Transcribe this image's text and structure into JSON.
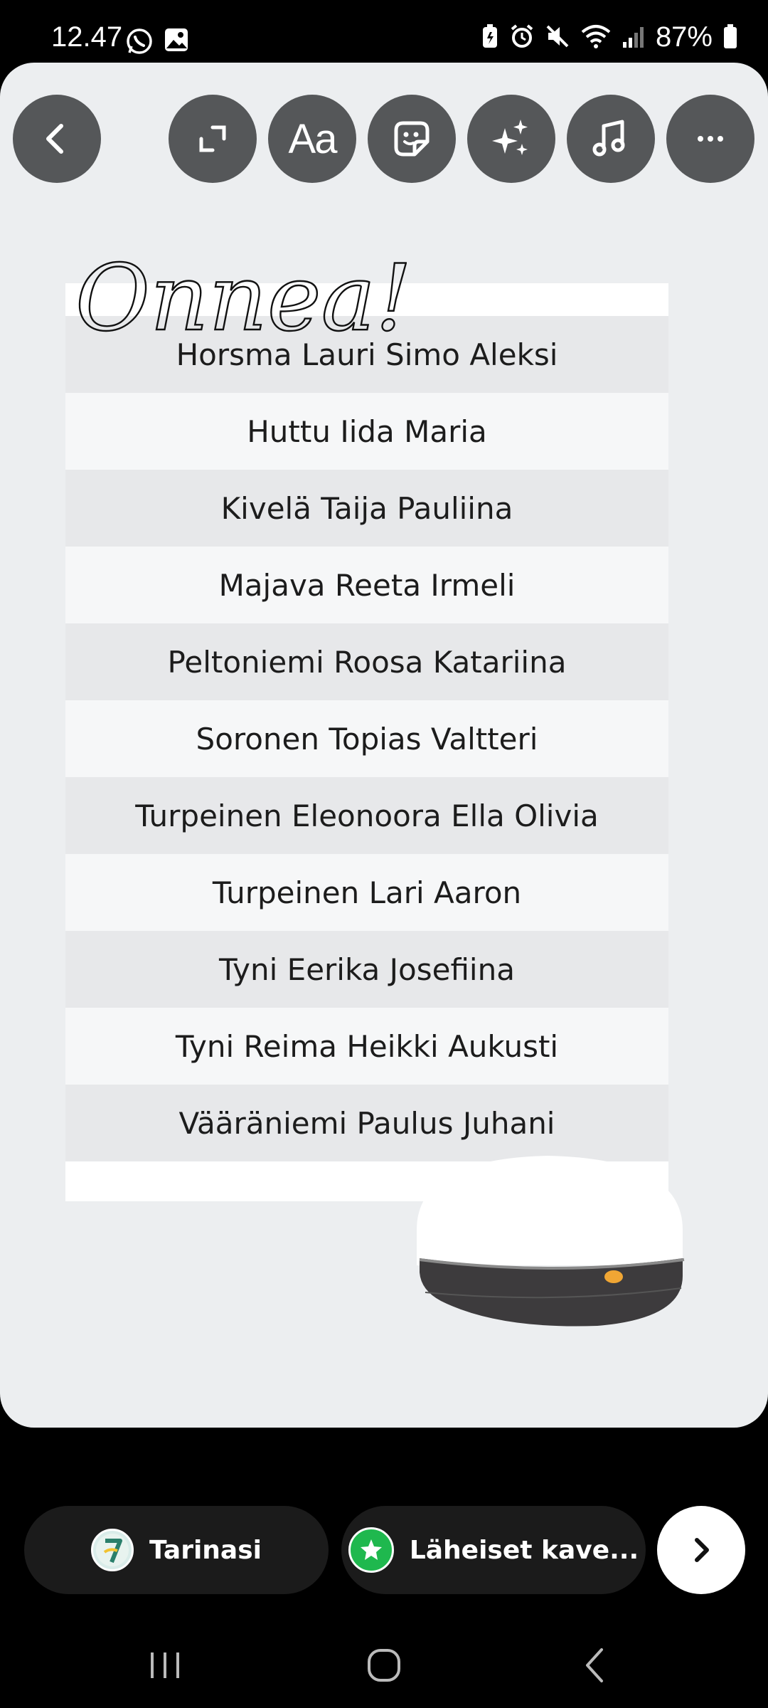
{
  "status_bar": {
    "time": "12.47",
    "battery": "87%"
  },
  "story": {
    "title": "Onnea!",
    "names": [
      "Horsma Lauri Simo Aleksi",
      "Huttu Iida Maria",
      "Kivelä Taija Pauliina",
      "Majava Reeta Irmeli",
      "Peltoniemi Roosa Katariina",
      "Soronen Topias Valtteri",
      "Turpeinen Eleonoora Ella Olivia",
      "Turpeinen Lari Aaron",
      "Tyni Eerika Josefiina",
      "Tyni Reima Heikki Aukusti",
      "Vääräniemi Paulus Juhani"
    ]
  },
  "toolbar": {
    "text_tool_label": "Aa",
    "icons": [
      "back-icon",
      "expand-icon",
      "text-icon",
      "sticker-icon",
      "effects-icon",
      "music-icon",
      "more-icon"
    ]
  },
  "share": {
    "story_label": "Tarinasi",
    "close_friends_label": "Läheiset kave..."
  },
  "colors": {
    "canvas": "#eceef0",
    "toolbar_button": "#555759",
    "close_friends_green": "#1fb84e"
  }
}
